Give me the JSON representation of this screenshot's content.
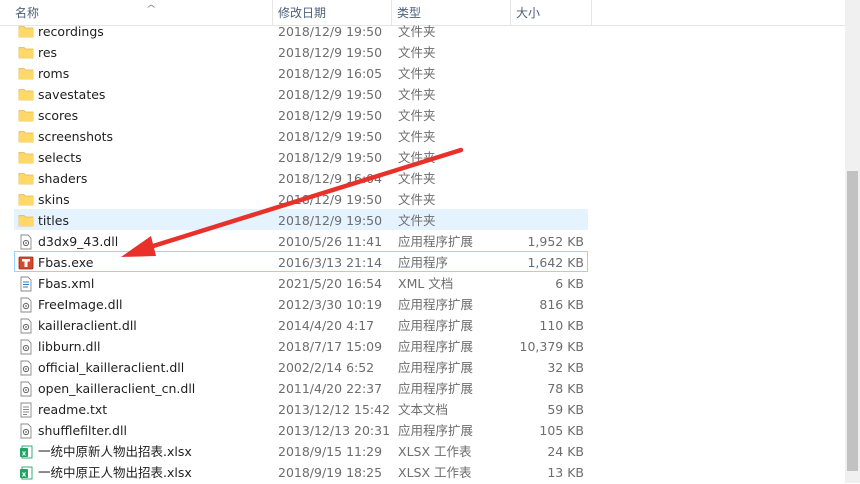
{
  "columns": {
    "name": "名称",
    "date": "修改日期",
    "type": "类型",
    "size": "大小"
  },
  "files": [
    {
      "name": "recordings",
      "date": "2018/12/9 19:50",
      "type": "文件夹",
      "size": "",
      "icon": "folder-icon"
    },
    {
      "name": "res",
      "date": "2018/12/9 19:50",
      "type": "文件夹",
      "size": "",
      "icon": "folder-icon"
    },
    {
      "name": "roms",
      "date": "2018/12/9 16:05",
      "type": "文件夹",
      "size": "",
      "icon": "folder-icon"
    },
    {
      "name": "savestates",
      "date": "2018/12/9 19:50",
      "type": "文件夹",
      "size": "",
      "icon": "folder-icon"
    },
    {
      "name": "scores",
      "date": "2018/12/9 19:50",
      "type": "文件夹",
      "size": "",
      "icon": "folder-icon"
    },
    {
      "name": "screenshots",
      "date": "2018/12/9 19:50",
      "type": "文件夹",
      "size": "",
      "icon": "folder-icon"
    },
    {
      "name": "selects",
      "date": "2018/12/9 19:50",
      "type": "文件夹",
      "size": "",
      "icon": "folder-icon"
    },
    {
      "name": "shaders",
      "date": "2018/12/9 16:04",
      "type": "文件夹",
      "size": "",
      "icon": "folder-icon"
    },
    {
      "name": "skins",
      "date": "2018/12/9 19:50",
      "type": "文件夹",
      "size": "",
      "icon": "folder-icon"
    },
    {
      "name": "titles",
      "date": "2018/12/9 19:50",
      "type": "文件夹",
      "size": "",
      "icon": "folder-icon"
    },
    {
      "name": "d3dx9_43.dll",
      "date": "2010/5/26 11:41",
      "type": "应用程序扩展",
      "size": "1,952 KB",
      "icon": "dll-file-icon"
    },
    {
      "name": "Fbas.exe",
      "date": "2016/3/13 21:14",
      "type": "应用程序",
      "size": "1,642 KB",
      "icon": "exe-app-icon"
    },
    {
      "name": "Fbas.xml",
      "date": "2021/5/20 16:54",
      "type": "XML 文档",
      "size": "6 KB",
      "icon": "xml-file-icon"
    },
    {
      "name": "FreeImage.dll",
      "date": "2012/3/30 10:19",
      "type": "应用程序扩展",
      "size": "816 KB",
      "icon": "dll-file-icon"
    },
    {
      "name": "kailleraclient.dll",
      "date": "2014/4/20 4:17",
      "type": "应用程序扩展",
      "size": "110 KB",
      "icon": "dll-file-icon"
    },
    {
      "name": "libburn.dll",
      "date": "2018/7/17 15:09",
      "type": "应用程序扩展",
      "size": "10,379 KB",
      "icon": "dll-file-icon"
    },
    {
      "name": "official_kailleraclient.dll",
      "date": "2002/2/14 6:52",
      "type": "应用程序扩展",
      "size": "32 KB",
      "icon": "dll-file-icon"
    },
    {
      "name": "open_kailleraclient_cn.dll",
      "date": "2011/4/20 22:37",
      "type": "应用程序扩展",
      "size": "78 KB",
      "icon": "dll-file-icon"
    },
    {
      "name": "readme.txt",
      "date": "2013/12/12 15:42",
      "type": "文本文档",
      "size": "59 KB",
      "icon": "txt-file-icon"
    },
    {
      "name": "shufflefilter.dll",
      "date": "2013/12/13 20:31",
      "type": "应用程序扩展",
      "size": "105 KB",
      "icon": "dll-file-icon"
    },
    {
      "name": "一统中原新人物出招表.xlsx",
      "date": "2018/9/15 11:29",
      "type": "XLSX 工作表",
      "size": "24 KB",
      "icon": "xlsx-file-icon"
    },
    {
      "name": "一统中原正人物出招表.xlsx",
      "date": "2018/9/19 18:25",
      "type": "XLSX 工作表",
      "size": "13 KB",
      "icon": "xlsx-file-icon"
    }
  ],
  "state": {
    "hover_row": 9,
    "focus_row": 11
  },
  "annotation": {
    "arrow_color": "#e8312a"
  },
  "colors": {
    "folder": "#f8d775",
    "hover": "#e5f3ff",
    "focus_border": "#99d1ff",
    "xlsx": "#21a366"
  }
}
